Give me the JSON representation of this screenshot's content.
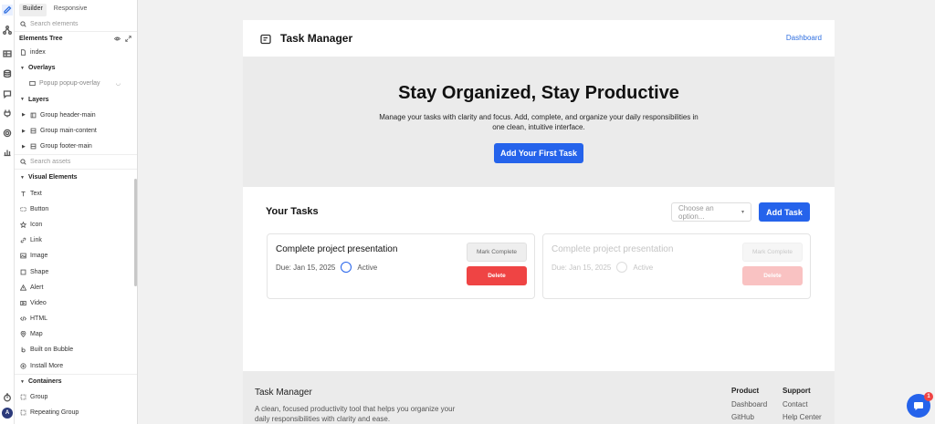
{
  "panel": {
    "tabs": [
      "Builder",
      "Responsive"
    ],
    "search_elements_placeholder": "Search elements",
    "elements_tree_title": "Elements Tree",
    "tree": {
      "index": "index",
      "overlays": "Overlays",
      "popup": "Popup popup-overlay",
      "layers": "Layers",
      "group_header": "Group header-main",
      "group_content": "Group main-content",
      "group_footer": "Group footer-main"
    },
    "search_assets_placeholder": "Search assets",
    "visual_title": "Visual Elements",
    "visual_items": [
      "Text",
      "Button",
      "Icon",
      "Link",
      "Image",
      "Shape",
      "Alert",
      "Video",
      "HTML",
      "Map",
      "Built on Bubble",
      "Install More"
    ],
    "containers_title": "Containers",
    "container_items": [
      "Group",
      "Repeating Group"
    ]
  },
  "app": {
    "brand": "Task Manager",
    "nav_dashboard": "Dashboard",
    "hero_title": "Stay Organized, Stay Productive",
    "hero_text": "Manage your tasks with clarity and focus. Add, complete, and organize your daily responsibilities in one clean, intuitive interface.",
    "hero_button": "Add Your First Task",
    "tasks_title": "Your Tasks",
    "select_placeholder": "Choose an option...",
    "add_task": "Add Task",
    "cards": [
      {
        "title": "Complete project presentation",
        "due": "Due: Jan 15, 2025",
        "status": "Active",
        "mark": "Mark Complete",
        "delete": "Delete"
      },
      {
        "title": "Complete project presentation",
        "due": "Due: Jan 15, 2025",
        "status": "Active",
        "mark": "Mark Complete",
        "delete": "Delete"
      }
    ],
    "footer": {
      "brand": "Task Manager",
      "desc": "A clean, focused productivity tool that helps you organize your daily responsibilities with clarity and ease.",
      "col1_title": "Product",
      "col1_links": [
        "Dashboard",
        "GitHub"
      ],
      "col2_title": "Support",
      "col2_links": [
        "Contact",
        "Help Center"
      ]
    }
  },
  "chat_badge": "1",
  "colors": {
    "accent": "#2563eb",
    "danger": "#ef4444"
  }
}
